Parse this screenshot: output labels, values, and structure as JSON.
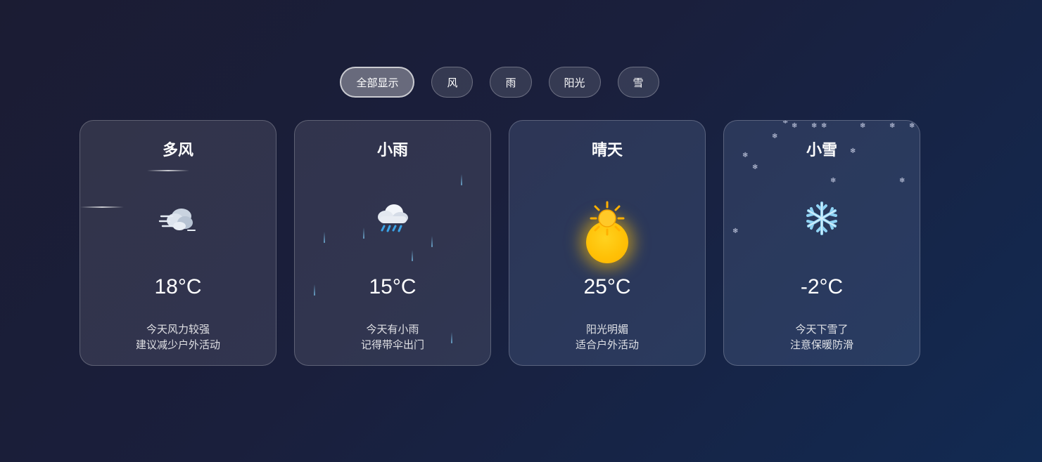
{
  "filters": {
    "all": "全部显示",
    "wind": "风",
    "rain": "雨",
    "sun": "阳光",
    "snow": "雪"
  },
  "cards": [
    {
      "title": "多风",
      "temp": "18°C",
      "desc1": "今天风力较强",
      "desc2": "建议减少户外活动",
      "icon": "wind-face-icon"
    },
    {
      "title": "小雨",
      "temp": "15°C",
      "desc1": "今天有小雨",
      "desc2": "记得带伞出门",
      "icon": "cloud-rain-icon"
    },
    {
      "title": "晴天",
      "temp": "25°C",
      "desc1": "阳光明媚",
      "desc2": "适合户外活动",
      "icon": "sun-icon"
    },
    {
      "title": "小雪",
      "temp": "-2°C",
      "desc1": "今天下雪了",
      "desc2": "注意保暖防滑",
      "icon": "snowflake-icon"
    }
  ],
  "colors": {
    "sun": "#ffc107",
    "rain": "#78bee6",
    "background_start": "#1b1c33",
    "background_end": "#122a52"
  }
}
